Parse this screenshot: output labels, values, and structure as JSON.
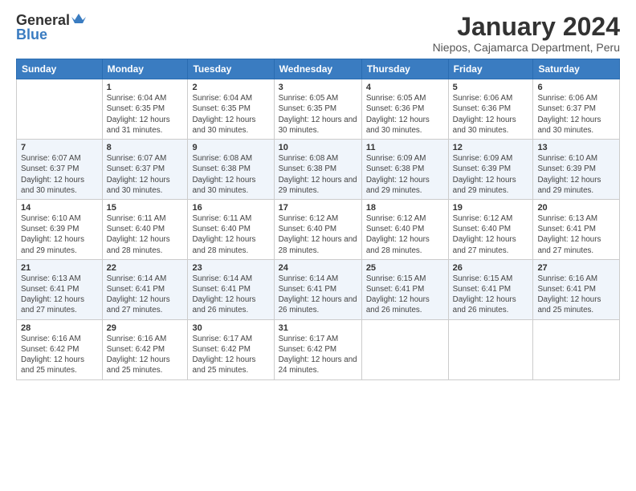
{
  "logo": {
    "general": "General",
    "blue": "Blue"
  },
  "title": "January 2024",
  "subtitle": "Niepos, Cajamarca Department, Peru",
  "weekdays": [
    "Sunday",
    "Monday",
    "Tuesday",
    "Wednesday",
    "Thursday",
    "Friday",
    "Saturday"
  ],
  "weeks": [
    [
      {
        "day": "",
        "sunrise": "",
        "sunset": "",
        "daylight": ""
      },
      {
        "day": "1",
        "sunrise": "Sunrise: 6:04 AM",
        "sunset": "Sunset: 6:35 PM",
        "daylight": "Daylight: 12 hours and 31 minutes."
      },
      {
        "day": "2",
        "sunrise": "Sunrise: 6:04 AM",
        "sunset": "Sunset: 6:35 PM",
        "daylight": "Daylight: 12 hours and 30 minutes."
      },
      {
        "day": "3",
        "sunrise": "Sunrise: 6:05 AM",
        "sunset": "Sunset: 6:35 PM",
        "daylight": "Daylight: 12 hours and 30 minutes."
      },
      {
        "day": "4",
        "sunrise": "Sunrise: 6:05 AM",
        "sunset": "Sunset: 6:36 PM",
        "daylight": "Daylight: 12 hours and 30 minutes."
      },
      {
        "day": "5",
        "sunrise": "Sunrise: 6:06 AM",
        "sunset": "Sunset: 6:36 PM",
        "daylight": "Daylight: 12 hours and 30 minutes."
      },
      {
        "day": "6",
        "sunrise": "Sunrise: 6:06 AM",
        "sunset": "Sunset: 6:37 PM",
        "daylight": "Daylight: 12 hours and 30 minutes."
      }
    ],
    [
      {
        "day": "7",
        "sunrise": "Sunrise: 6:07 AM",
        "sunset": "Sunset: 6:37 PM",
        "daylight": "Daylight: 12 hours and 30 minutes."
      },
      {
        "day": "8",
        "sunrise": "Sunrise: 6:07 AM",
        "sunset": "Sunset: 6:37 PM",
        "daylight": "Daylight: 12 hours and 30 minutes."
      },
      {
        "day": "9",
        "sunrise": "Sunrise: 6:08 AM",
        "sunset": "Sunset: 6:38 PM",
        "daylight": "Daylight: 12 hours and 30 minutes."
      },
      {
        "day": "10",
        "sunrise": "Sunrise: 6:08 AM",
        "sunset": "Sunset: 6:38 PM",
        "daylight": "Daylight: 12 hours and 29 minutes."
      },
      {
        "day": "11",
        "sunrise": "Sunrise: 6:09 AM",
        "sunset": "Sunset: 6:38 PM",
        "daylight": "Daylight: 12 hours and 29 minutes."
      },
      {
        "day": "12",
        "sunrise": "Sunrise: 6:09 AM",
        "sunset": "Sunset: 6:39 PM",
        "daylight": "Daylight: 12 hours and 29 minutes."
      },
      {
        "day": "13",
        "sunrise": "Sunrise: 6:10 AM",
        "sunset": "Sunset: 6:39 PM",
        "daylight": "Daylight: 12 hours and 29 minutes."
      }
    ],
    [
      {
        "day": "14",
        "sunrise": "Sunrise: 6:10 AM",
        "sunset": "Sunset: 6:39 PM",
        "daylight": "Daylight: 12 hours and 29 minutes."
      },
      {
        "day": "15",
        "sunrise": "Sunrise: 6:11 AM",
        "sunset": "Sunset: 6:40 PM",
        "daylight": "Daylight: 12 hours and 28 minutes."
      },
      {
        "day": "16",
        "sunrise": "Sunrise: 6:11 AM",
        "sunset": "Sunset: 6:40 PM",
        "daylight": "Daylight: 12 hours and 28 minutes."
      },
      {
        "day": "17",
        "sunrise": "Sunrise: 6:12 AM",
        "sunset": "Sunset: 6:40 PM",
        "daylight": "Daylight: 12 hours and 28 minutes."
      },
      {
        "day": "18",
        "sunrise": "Sunrise: 6:12 AM",
        "sunset": "Sunset: 6:40 PM",
        "daylight": "Daylight: 12 hours and 28 minutes."
      },
      {
        "day": "19",
        "sunrise": "Sunrise: 6:12 AM",
        "sunset": "Sunset: 6:40 PM",
        "daylight": "Daylight: 12 hours and 27 minutes."
      },
      {
        "day": "20",
        "sunrise": "Sunrise: 6:13 AM",
        "sunset": "Sunset: 6:41 PM",
        "daylight": "Daylight: 12 hours and 27 minutes."
      }
    ],
    [
      {
        "day": "21",
        "sunrise": "Sunrise: 6:13 AM",
        "sunset": "Sunset: 6:41 PM",
        "daylight": "Daylight: 12 hours and 27 minutes."
      },
      {
        "day": "22",
        "sunrise": "Sunrise: 6:14 AM",
        "sunset": "Sunset: 6:41 PM",
        "daylight": "Daylight: 12 hours and 27 minutes."
      },
      {
        "day": "23",
        "sunrise": "Sunrise: 6:14 AM",
        "sunset": "Sunset: 6:41 PM",
        "daylight": "Daylight: 12 hours and 26 minutes."
      },
      {
        "day": "24",
        "sunrise": "Sunrise: 6:14 AM",
        "sunset": "Sunset: 6:41 PM",
        "daylight": "Daylight: 12 hours and 26 minutes."
      },
      {
        "day": "25",
        "sunrise": "Sunrise: 6:15 AM",
        "sunset": "Sunset: 6:41 PM",
        "daylight": "Daylight: 12 hours and 26 minutes."
      },
      {
        "day": "26",
        "sunrise": "Sunrise: 6:15 AM",
        "sunset": "Sunset: 6:41 PM",
        "daylight": "Daylight: 12 hours and 26 minutes."
      },
      {
        "day": "27",
        "sunrise": "Sunrise: 6:16 AM",
        "sunset": "Sunset: 6:41 PM",
        "daylight": "Daylight: 12 hours and 25 minutes."
      }
    ],
    [
      {
        "day": "28",
        "sunrise": "Sunrise: 6:16 AM",
        "sunset": "Sunset: 6:42 PM",
        "daylight": "Daylight: 12 hours and 25 minutes."
      },
      {
        "day": "29",
        "sunrise": "Sunrise: 6:16 AM",
        "sunset": "Sunset: 6:42 PM",
        "daylight": "Daylight: 12 hours and 25 minutes."
      },
      {
        "day": "30",
        "sunrise": "Sunrise: 6:17 AM",
        "sunset": "Sunset: 6:42 PM",
        "daylight": "Daylight: 12 hours and 25 minutes."
      },
      {
        "day": "31",
        "sunrise": "Sunrise: 6:17 AM",
        "sunset": "Sunset: 6:42 PM",
        "daylight": "Daylight: 12 hours and 24 minutes."
      },
      {
        "day": "",
        "sunrise": "",
        "sunset": "",
        "daylight": ""
      },
      {
        "day": "",
        "sunrise": "",
        "sunset": "",
        "daylight": ""
      },
      {
        "day": "",
        "sunrise": "",
        "sunset": "",
        "daylight": ""
      }
    ]
  ]
}
